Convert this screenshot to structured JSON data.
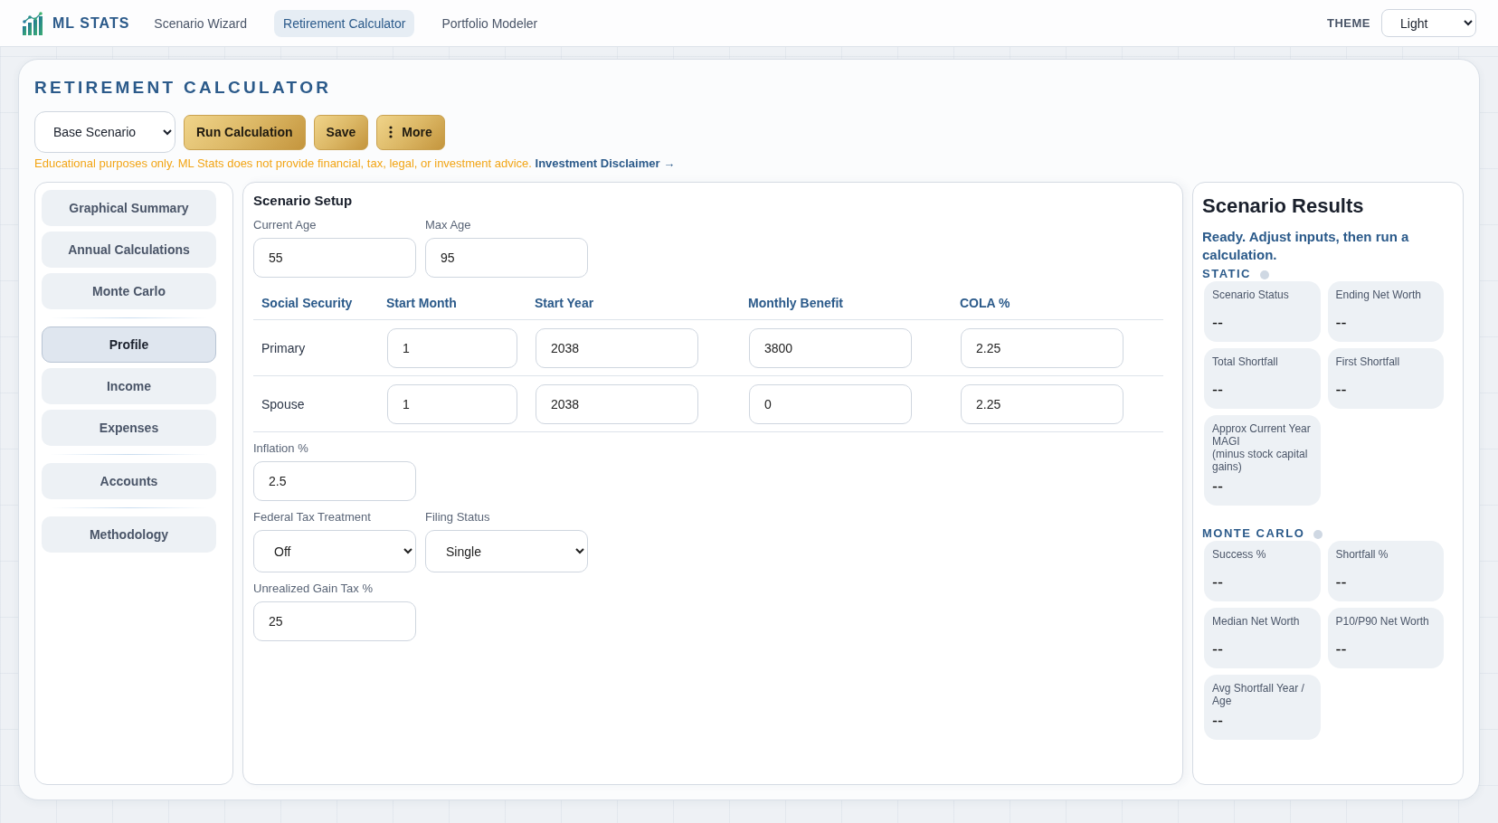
{
  "top_bar": {
    "brand": "ML STATS",
    "nav": [
      {
        "label": "Scenario Wizard",
        "selected": false
      },
      {
        "label": "Retirement Calculator",
        "selected": true
      },
      {
        "label": "Portfolio Modeler",
        "selected": false
      }
    ],
    "theme": {
      "label": "THEME",
      "value": "Light"
    }
  },
  "header": {
    "title": "RETIREMENT CALCULATOR",
    "scenario": "Base Scenario",
    "buttons": [
      {
        "label": "Run Calculation",
        "kind": "button"
      },
      {
        "label": "Save",
        "kind": "button"
      },
      {
        "label": "More",
        "kind": "menu"
      }
    ],
    "disclaimer": {
      "text": "Educational purposes only. ML Stats does not provide financial, tax, legal, or investment advice.",
      "link": "Investment Disclaimer →"
    }
  },
  "sidebar": {
    "groups": [
      {
        "items": [
          {
            "label": "Graphical Summary",
            "selected": false
          },
          {
            "label": "Annual Calculations",
            "selected": false
          },
          {
            "label": "Monte Carlo",
            "selected": false
          }
        ]
      },
      {
        "items": [
          {
            "label": "Profile",
            "selected": true
          },
          {
            "label": "Income",
            "selected": false
          },
          {
            "label": "Expenses",
            "selected": false
          }
        ]
      },
      {
        "items": [
          {
            "label": "Accounts",
            "selected": false
          }
        ]
      },
      {
        "items": [
          {
            "label": "Methodology",
            "selected": false
          }
        ]
      }
    ]
  },
  "setup": {
    "title": "Scenario Setup",
    "fields_before": [
      [
        {
          "label": "Current Age",
          "value": "55",
          "kind": "input"
        },
        {
          "label": "Max Age",
          "value": "95",
          "kind": "input"
        }
      ]
    ],
    "social_security": {
      "columns": [
        "Social Security",
        "Start Month",
        "Start Year",
        "Monthly Benefit",
        "COLA %"
      ],
      "rows": [
        {
          "name": "Primary",
          "values": [
            "1",
            "2038",
            "3800",
            "2.25"
          ]
        },
        {
          "name": "Spouse",
          "values": [
            "1",
            "2038",
            "0",
            "2.25"
          ]
        }
      ]
    },
    "fields_after": [
      [
        {
          "label": "Inflation %",
          "value": "2.5",
          "kind": "input"
        }
      ],
      [
        {
          "label": "Federal Tax Treatment",
          "value": "Off",
          "kind": "select"
        },
        {
          "label": "Filing Status",
          "value": "Single",
          "kind": "select"
        }
      ],
      [
        {
          "label": "Unrealized Gain Tax %",
          "value": "25",
          "kind": "input"
        }
      ]
    ]
  },
  "results": {
    "title": "Scenario Results",
    "status": "Ready. Adjust inputs, then run a calculation.",
    "sections": [
      {
        "title": "STATIC",
        "cards": [
          {
            "label": "Scenario Status",
            "value": "--"
          },
          {
            "label": "Ending Net Worth",
            "value": "--"
          },
          {
            "label": "Total Shortfall",
            "value": "--"
          },
          {
            "label": "First Shortfall",
            "value": "--"
          },
          {
            "label": "Approx Current Year MAGI\n(minus stock capital gains)",
            "value": "--"
          }
        ]
      },
      {
        "title": "MONTE CARLO",
        "cards": [
          {
            "label": "Success %",
            "value": "--"
          },
          {
            "label": "Shortfall %",
            "value": "--"
          },
          {
            "label": "Median Net Worth",
            "value": "--"
          },
          {
            "label": "P10/P90 Net Worth",
            "value": "--"
          },
          {
            "label": "Avg Shortfall Year / Age",
            "value": "--"
          }
        ]
      }
    ]
  }
}
